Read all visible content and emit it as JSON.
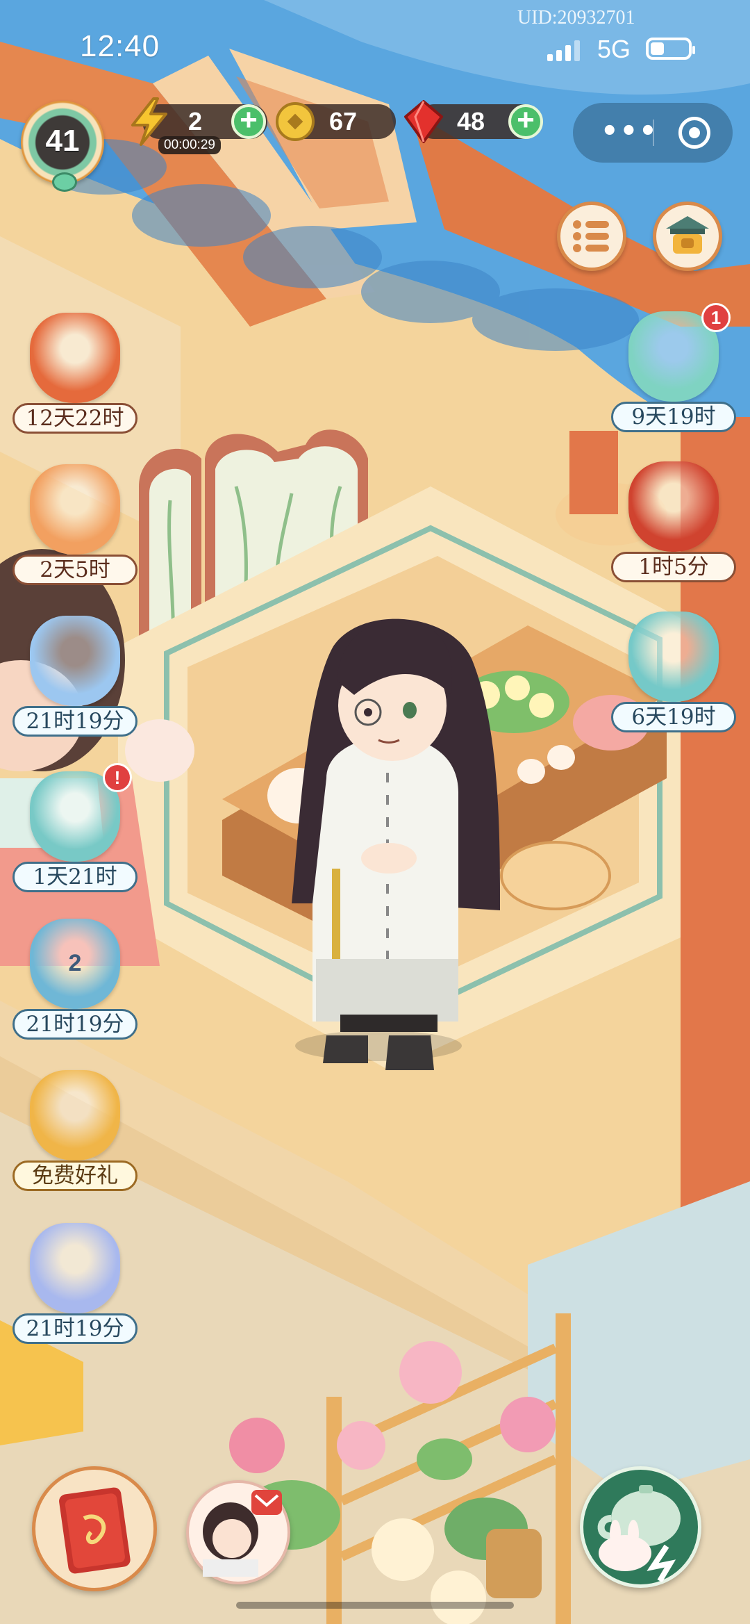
{
  "status_bar": {
    "time": "12:40",
    "uid": "UID:20932701",
    "network": "5G",
    "battery_level": 0.35
  },
  "player": {
    "level": "41"
  },
  "resources": {
    "energy": {
      "value": "2",
      "timer": "00:00:29",
      "icon": "lightning-icon"
    },
    "coins": {
      "value": "67",
      "icon": "coin-icon"
    },
    "gems": {
      "value": "48",
      "icon": "red-gem-icon"
    }
  },
  "top_right_buttons": [
    {
      "icon": "menu-list-icon"
    },
    {
      "icon": "shop-gate-icon"
    }
  ],
  "left_events": [
    {
      "label": "12天22时",
      "icon": "book-scroll-icon",
      "color": "#e56a3c"
    },
    {
      "label": "2天5时",
      "icon": "treasure-chest-icon",
      "color": "#f2a060"
    },
    {
      "label": "21时19分",
      "icon": "snow-cat-icon",
      "color": "#9cc7f0"
    },
    {
      "label": "1天21时",
      "icon": "autumn-cauldron-icon",
      "color": "#78c9c6",
      "alert": "!"
    },
    {
      "label": "21时19分",
      "icon": "lotus-icon",
      "color": "#6fb7d6",
      "count": "2"
    },
    {
      "label": "免费好礼",
      "icon": "gift-lantern-icon",
      "color": "#f0b548"
    },
    {
      "label": "21时19分",
      "icon": "blue-hat-icon",
      "color": "#a8b8ee"
    }
  ],
  "right_events": [
    {
      "label": "9天19时",
      "icon": "green-cat-icon",
      "color": "#7fd3c2",
      "badge": "1"
    },
    {
      "label": "1时5分",
      "icon": "red-box-icon",
      "color": "#d0432f"
    },
    {
      "label": "6天19时",
      "icon": "gift-cat-icon",
      "color": "#75c9c8"
    }
  ],
  "bottom_buttons": [
    {
      "icon": "red-book-icon"
    },
    {
      "icon": "character-mail-icon"
    },
    {
      "icon": "teapot-bunny-icon"
    }
  ]
}
